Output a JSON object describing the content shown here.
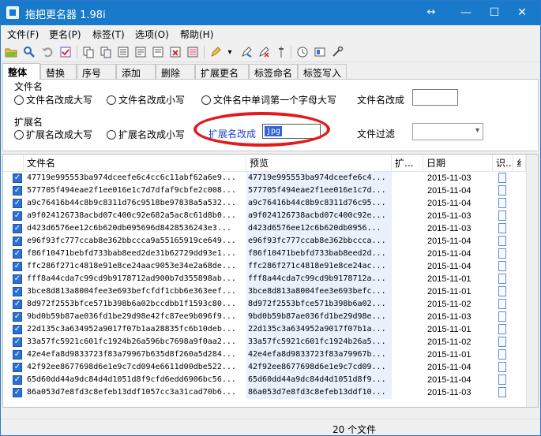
{
  "window": {
    "title": "拖把更名器 1.98i",
    "resize_glyph": "↔",
    "minimize_glyph": "—",
    "maximize_glyph": "☐",
    "close_glyph": "✕"
  },
  "menu": [
    "文件(F)",
    "更名(P)",
    "标签(T)",
    "选项(O)",
    "帮助(H)"
  ],
  "toolbar": {
    "icons": [
      "open-folder-icon",
      "search-icon",
      "undo-icon",
      "checkbox-icon",
      "copy-icon",
      "paste-icon",
      "list-icon",
      "export-icon",
      "import-icon",
      "pencil-icon",
      "dropdown-arrow-icon",
      "rename-icon",
      "clear-icon",
      "pin-icon",
      "clock-icon",
      "image-icon",
      "tools-icon"
    ],
    "dropdown_glyph": "▾"
  },
  "tabs": [
    "整体",
    "替换",
    "序号",
    "添加",
    "删除",
    "扩展更名",
    "标签命名",
    "标签写入"
  ],
  "options": {
    "filename_group": "文件名",
    "filename_upper": "文件名改成大写",
    "filename_lower": "文件名改成小写",
    "filename_title": "文件名中单词第一个字母大写",
    "filename_change_label": "文件名改成",
    "filename_change_value": "",
    "ext_group": "扩展名",
    "ext_upper": "扩展名改成大写",
    "ext_lower": "扩展名改成小写",
    "ext_change_label": "扩展名改成",
    "ext_change_value": "jpg",
    "file_filter_label": "文件过滤",
    "file_filter_value": "",
    "dropdown_glyph": "▾"
  },
  "table": {
    "columns": [
      "文件名",
      "预览",
      "扩...",
      "日期",
      "识...",
      "纟"
    ],
    "rows": [
      {
        "name": "47719e995553ba974dceefe6c4cc6c11abf62a6e9...",
        "preview": "47719e995553ba974dceefe6c4...",
        "date": "2015-11-03"
      },
      {
        "name": "577705f494eae2f1ee016e1c7d7dfaf9cbfe2c008...",
        "preview": "577705f494eae2f1ee016e1c7d...",
        "date": "2015-11-04"
      },
      {
        "name": "a9c76416b44c8b9c8311d76c9518be97838a5a532...",
        "preview": "a9c76416b44c8b9c8311d76c95...",
        "date": "2015-11-04"
      },
      {
        "name": "a9f024126738acbd07c400c92e682a5ac8c61d8b0...",
        "preview": "a9f024126738acbd07c400c92e...",
        "date": "2015-11-03"
      },
      {
        "name": "d423d6576ee12c6b620db095696d8428536243e3...",
        "preview": "d423d6576ee12c6b620db0956...",
        "date": "2015-11-03"
      },
      {
        "name": "e96f93fc777ccab8e362bbccca9a55165919ce649...",
        "preview": "e96f93fc777ccab8e362bbccca...",
        "date": "2015-11-04"
      },
      {
        "name": "f86f10471bebfd733bab8eed2de31b62729dd93e1...",
        "preview": "f86f10471bebfd733bab8eed2d...",
        "date": "2015-11-04"
      },
      {
        "name": "ffc286f271c4818e91e8ce24aac9053e34e2a68de...",
        "preview": "ffc286f271c4818e91e8ce24ac...",
        "date": "2015-11-04"
      },
      {
        "name": "fff8a44cda7c99cd9b9178712ad900b7d355898ab...",
        "preview": "fff8a44cda7c99cd9b9178712a...",
        "date": "2015-11-01"
      },
      {
        "name": "3bce8d813a8004fee3e693befcfdf1cbb6e363eef...",
        "preview": "3bce8d813a8004fee3e693befc...",
        "date": "2015-11-01"
      },
      {
        "name": "8d972f2553bfce571b398b6a02bccdbb1f1593c80...",
        "preview": "8d972f2553bfce571b398b6a02...",
        "date": "2015-11-02"
      },
      {
        "name": "9bd0b59b87ae036fd1be29d98e42fc87ee9b096f9...",
        "preview": "9bd0b59b87ae036fd1be29d98e...",
        "date": "2015-11-03"
      },
      {
        "name": "22d135c3a634952a9017f07b1aa28835fc6b10deb...",
        "preview": "22d135c3a634952a9017f07b1a...",
        "date": "2015-11-01"
      },
      {
        "name": "33a57fc5921c601fc1924b26a596bc7698a9f0aa2...",
        "preview": "33a57fc5921c601fc1924b26a5...",
        "date": "2015-11-02"
      },
      {
        "name": "42e4efa8d9833723f83a79967b635d8f260a5d284...",
        "preview": "42e4efa8d9833723f83a79967b...",
        "date": "2015-11-01"
      },
      {
        "name": "42f92ee8677698d6e1e9c7cd094e6611d00dbe522...",
        "preview": "42f92ee8677698d6e1e9c7cd09...",
        "date": "2015-11-04"
      },
      {
        "name": "65d60dd44a9dc84d4d1051d8f9cfd6edd6906bc56...",
        "preview": "65d60dd44a9dc84d4d1051d8f9...",
        "date": "2015-11-04"
      },
      {
        "name": "86a053d7e8fd3c8efeb13ddf1057cc3a31cad70b6...",
        "preview": "86a053d7e8fd3c8efeb13ddf10...",
        "date": "2015-11-03"
      }
    ]
  },
  "status": "20 个文件",
  "colors": {
    "titlebar": "#1979ca",
    "highlight": "#e11b1b",
    "checkbox": "#2a6fd1",
    "ext_label": "#1f3fd1"
  }
}
